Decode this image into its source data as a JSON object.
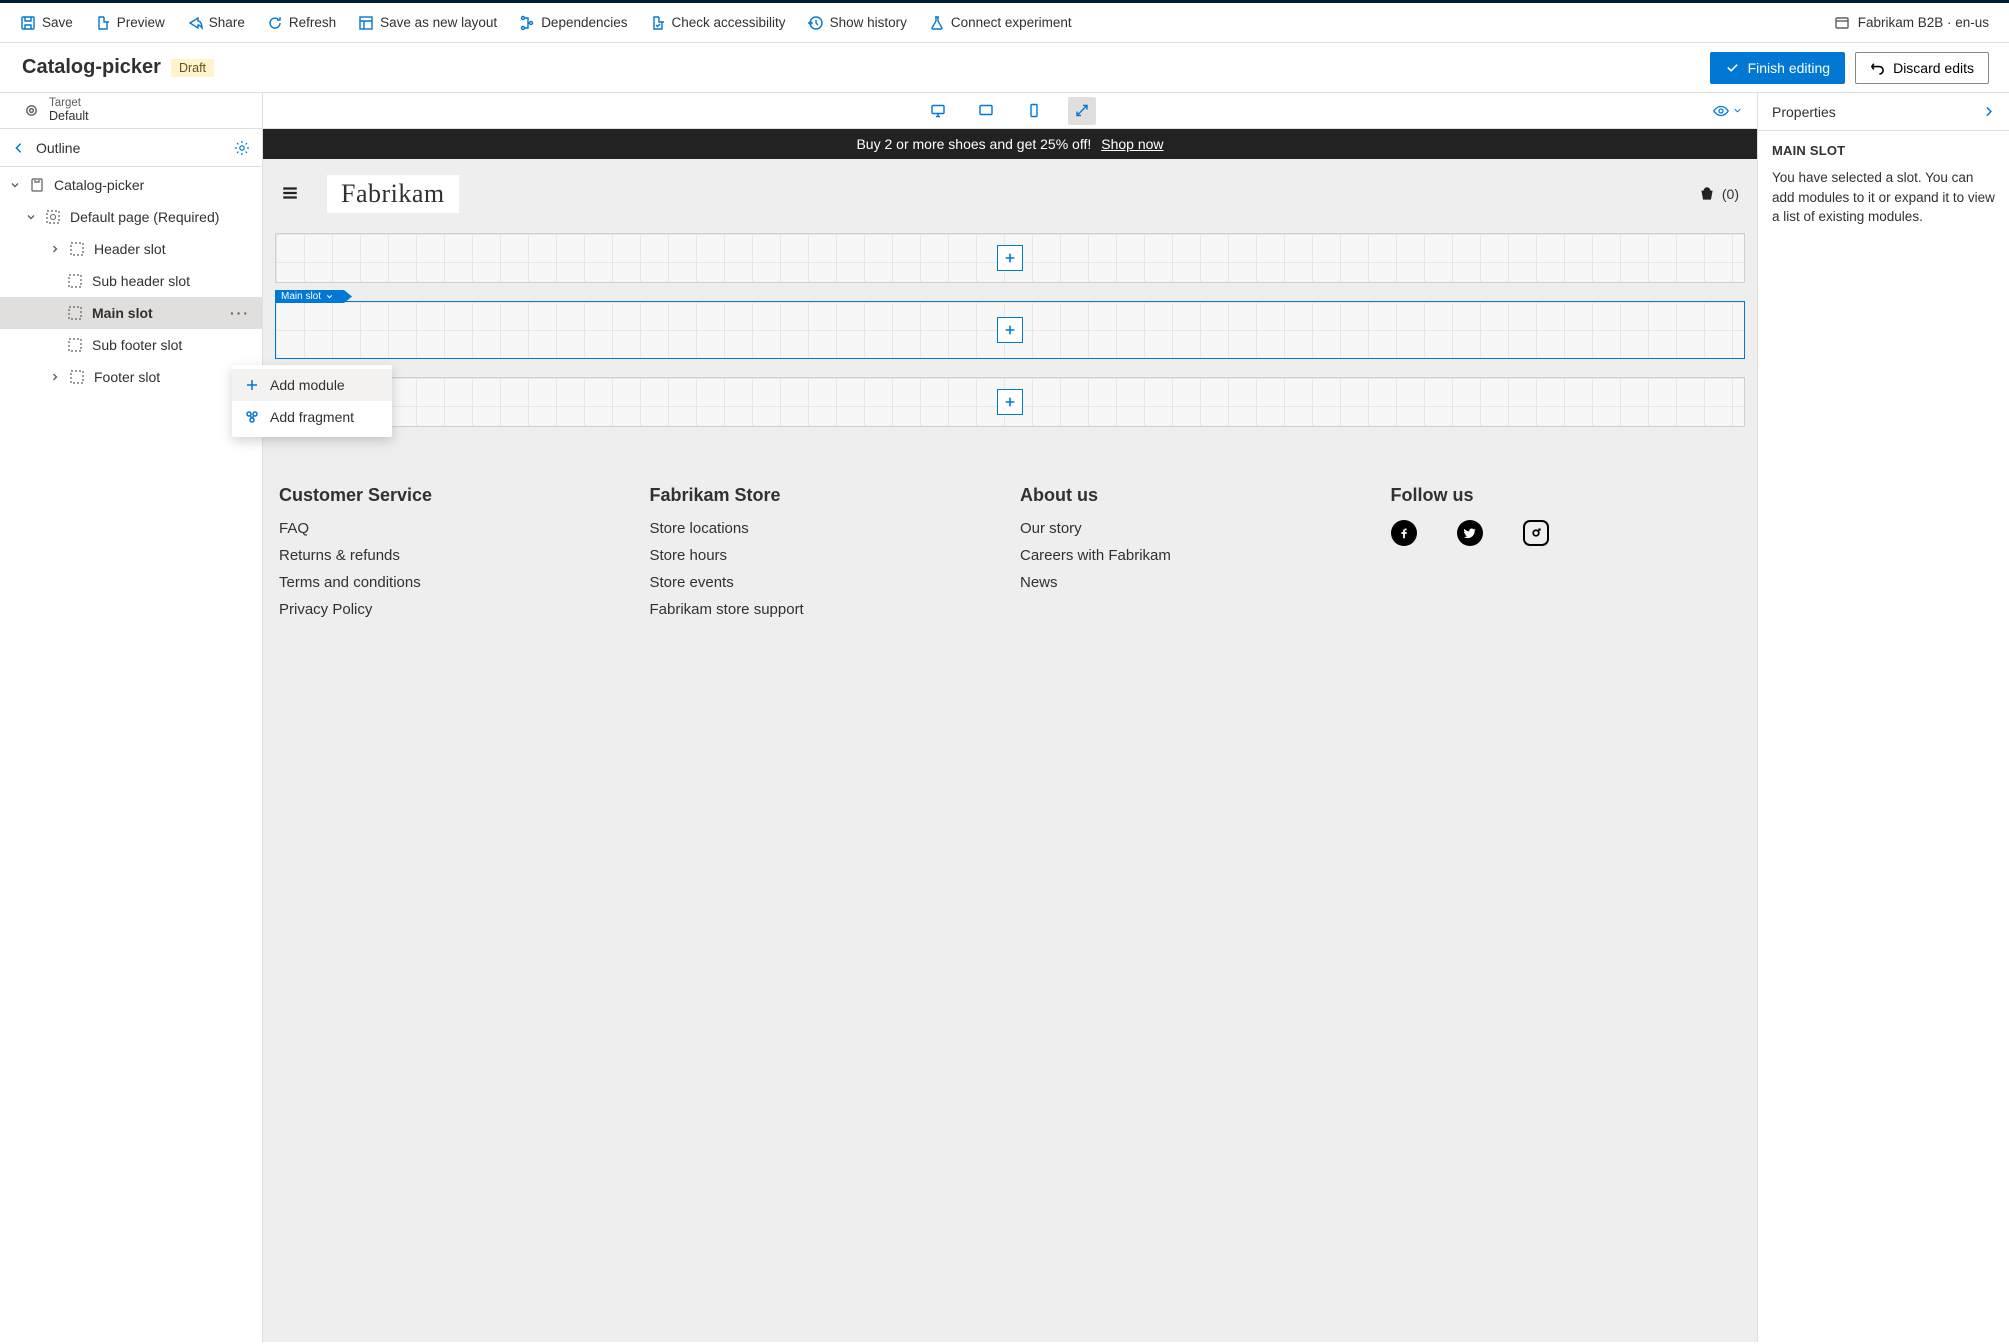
{
  "toolbar": {
    "save": "Save",
    "preview": "Preview",
    "share": "Share",
    "refresh": "Refresh",
    "save_as_layout": "Save as new layout",
    "dependencies": "Dependencies",
    "check_accessibility": "Check accessibility",
    "show_history": "Show history",
    "connect_experiment": "Connect experiment",
    "context": "Fabrikam B2B · en-us"
  },
  "title_bar": {
    "title": "Catalog-picker",
    "status": "Draft",
    "finish": "Finish editing",
    "discard": "Discard edits"
  },
  "target": {
    "label": "Target",
    "value": "Default"
  },
  "outline": {
    "header": "Outline",
    "tree": {
      "root": "Catalog-picker",
      "page": "Default page (Required)",
      "slots": {
        "header": "Header slot",
        "subheader": "Sub header slot",
        "main": "Main slot",
        "subfooter": "Sub footer slot",
        "footer": "Footer slot"
      }
    },
    "menu": {
      "add_module": "Add module",
      "add_fragment": "Add fragment"
    }
  },
  "canvas": {
    "promo_text": "Buy 2 or more shoes and get 25% off!",
    "promo_link": "Shop now",
    "brand": "Fabrikam",
    "cart_count": "(0)",
    "main_slot_tag": "Main slot"
  },
  "footer": {
    "cols": [
      {
        "title": "Customer Service",
        "links": [
          "FAQ",
          "Returns & refunds",
          "Terms and conditions",
          "Privacy Policy"
        ]
      },
      {
        "title": "Fabrikam Store",
        "links": [
          "Store locations",
          "Store hours",
          "Store events",
          "Fabrikam store support"
        ]
      },
      {
        "title": "About us",
        "links": [
          "Our story",
          "Careers with Fabrikam",
          "News"
        ]
      },
      {
        "title": "Follow us",
        "links": []
      }
    ]
  },
  "props": {
    "header": "Properties",
    "section_title": "MAIN SLOT",
    "body": "You have selected a slot. You can add modules to it or expand it to view a list of existing modules."
  }
}
